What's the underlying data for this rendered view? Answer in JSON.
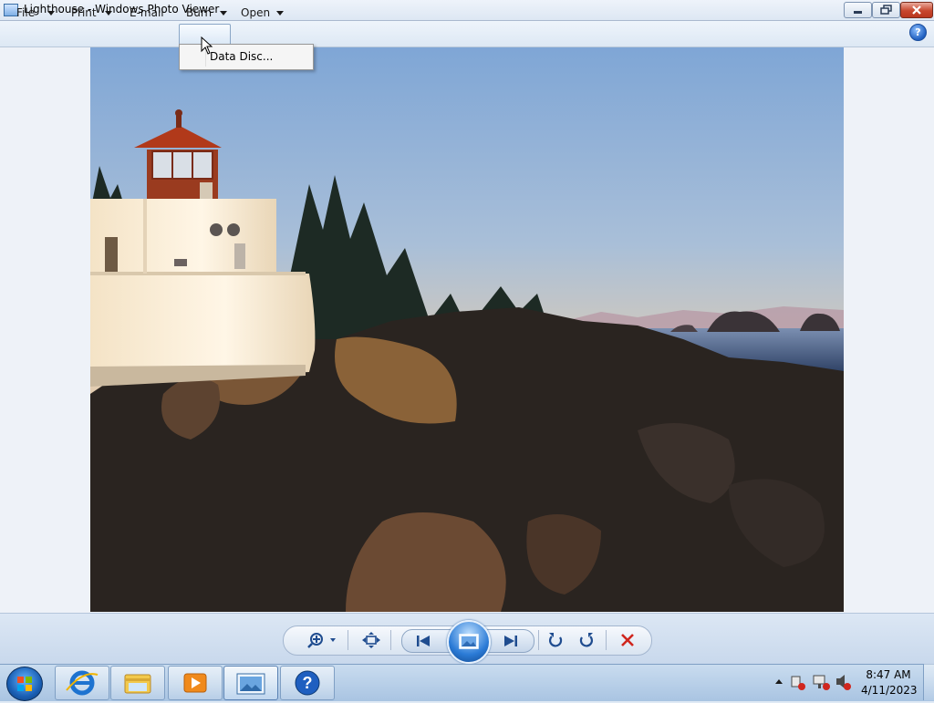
{
  "window": {
    "title": "Lighthouse - Windows Photo Viewer",
    "close_color": "#c7462e"
  },
  "menubar": {
    "items": [
      {
        "label": "File",
        "has_dropdown": true
      },
      {
        "label": "Print",
        "has_dropdown": true
      },
      {
        "label": "E-mail",
        "has_dropdown": false
      },
      {
        "label": "Burn",
        "has_dropdown": true,
        "active": true
      },
      {
        "label": "Open",
        "has_dropdown": true
      }
    ],
    "help_label": "?"
  },
  "burn_menu": {
    "items": [
      {
        "label": "Data Disc..."
      }
    ]
  },
  "photo": {
    "subject": "Lighthouse"
  },
  "controls": {
    "buttons": [
      "zoom-icon",
      "actual-size-icon",
      "previous-icon",
      "slideshow-icon",
      "next-icon",
      "rotate-counterclockwise-icon",
      "rotate-clockwise-icon",
      "delete-icon"
    ]
  },
  "taskbar": {
    "pinned": [
      "internet-explorer-icon",
      "windows-explorer-icon",
      "media-player-icon",
      "photo-viewer-icon",
      "help-icon"
    ],
    "help_label": "?",
    "clock": {
      "time": "8:47 AM",
      "date": "4/11/2023"
    }
  }
}
